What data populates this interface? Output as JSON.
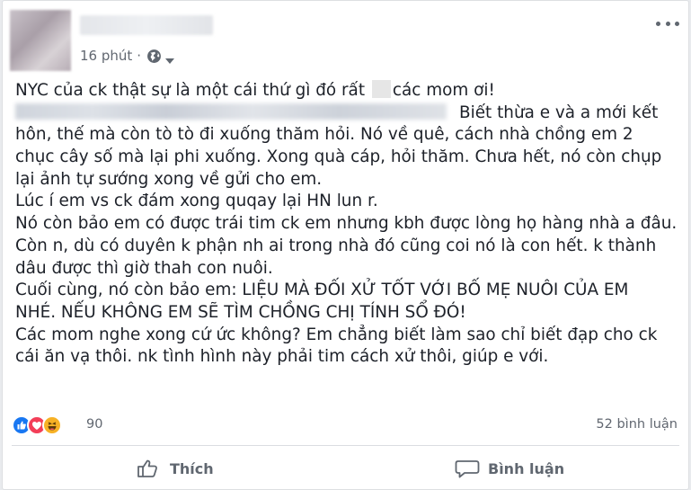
{
  "post": {
    "time": "16 phút",
    "separator": "·",
    "privacy_icon": "globe-icon",
    "lines": [
      "NYC của ck thật sự là một cái thứ gì đó rất",
      "các mom ơi!",
      "Biết thừa e và a mới kết",
      "hôn, thế mà còn tò tò đi xuống thăm hỏi. Nó về quê, cách nhà chồng em 2",
      "chục cây số mà lại phi xuống. Xong quà cáp, hỏi thăm. Chưa hết, nó còn chụp",
      "lại ảnh tự sướng xong về gửi cho em.",
      "Lúc í em vs ck đám xong quqay lại HN lun r.",
      "Nó còn bảo em có được trái tim ck em nhưng kbh được lòng họ hàng nhà a đâu.",
      "Còn n, dù có duyên k phận nh ai trong nhà đó cũng coi nó là con hết. k thành",
      "dâu được thì giờ thah con nuôi.",
      "Cuối cùng, nó còn bảo em: LIỆU MÀ ĐỐI XỬ TỐT VỚI BỐ MẸ NUÔI CỦA EM",
      "NHÉ. NẾU KHÔNG EM SẼ TÌM CHỒNG CHỊ TÍNH SỔ ĐÓ!",
      "Các mom nghe xong cứ ức không? Em chẳng biết làm sao chỉ biết đạp cho ck",
      "cái ăn vạ thôi. nk tình hình này phải tim cách xử thôi, giúp e với."
    ]
  },
  "reactions": {
    "icons": [
      "like-icon",
      "love-icon",
      "haha-icon"
    ],
    "count": "90",
    "comments": "52 bình luận"
  },
  "actions": {
    "like_label": "Thích",
    "comment_label": "Bình luận"
  },
  "colors": {
    "like_blue": "#1877f2",
    "love_red": "#f33e58",
    "haha_yellow": "#f7b125",
    "meta_gray": "#616770",
    "text": "#1d2129"
  }
}
